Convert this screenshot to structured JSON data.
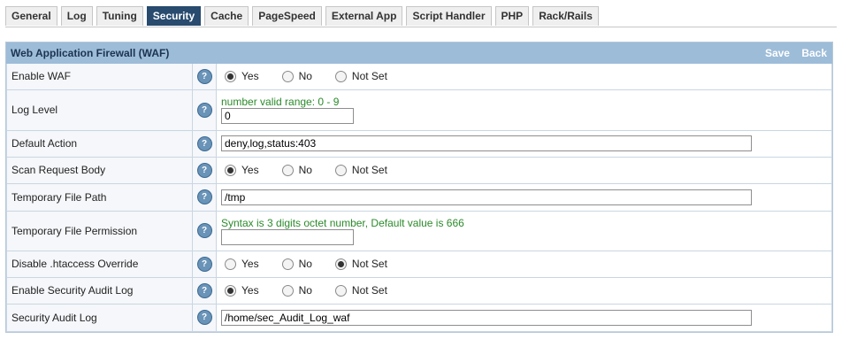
{
  "tabs": [
    {
      "label": "General",
      "active": false
    },
    {
      "label": "Log",
      "active": false
    },
    {
      "label": "Tuning",
      "active": false
    },
    {
      "label": "Security",
      "active": true
    },
    {
      "label": "Cache",
      "active": false
    },
    {
      "label": "PageSpeed",
      "active": false
    },
    {
      "label": "External App",
      "active": false
    },
    {
      "label": "Script Handler",
      "active": false
    },
    {
      "label": "PHP",
      "active": false
    },
    {
      "label": "Rack/Rails",
      "active": false
    }
  ],
  "panel": {
    "title": "Web Application Firewall (WAF)",
    "save_label": "Save",
    "back_label": "Back",
    "help_glyph": "?"
  },
  "radio_labels": {
    "yes": "Yes",
    "no": "No",
    "not_set": "Not Set"
  },
  "rows": {
    "enable_waf": {
      "label": "Enable WAF",
      "selected": "yes"
    },
    "log_level": {
      "label": "Log Level",
      "hint": "number valid range: 0 - 9",
      "value": "0"
    },
    "default_action": {
      "label": "Default Action",
      "value": "deny,log,status:403"
    },
    "scan_request_body": {
      "label": "Scan Request Body",
      "selected": "yes"
    },
    "temp_file_path": {
      "label": "Temporary File Path",
      "value": "/tmp"
    },
    "temp_file_permission": {
      "label": "Temporary File Permission",
      "hint": "Syntax is 3 digits octet number, Default value is 666",
      "value": ""
    },
    "disable_htaccess_override": {
      "label": "Disable .htaccess Override",
      "selected": "not_set"
    },
    "enable_security_audit_log": {
      "label": "Enable Security Audit Log",
      "selected": "yes"
    },
    "security_audit_log": {
      "label": "Security Audit Log",
      "value": "/home/sec_Audit_Log_waf"
    }
  }
}
